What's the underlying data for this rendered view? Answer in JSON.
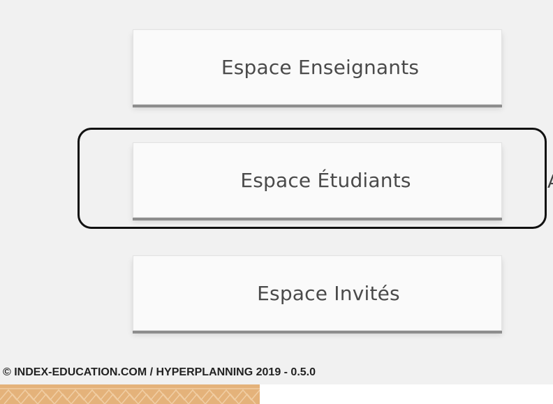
{
  "panel": {
    "background": "#f1f1f1"
  },
  "spaces": [
    {
      "label": "Espace Enseignants"
    },
    {
      "label": "Espace Étudiants"
    },
    {
      "label": "Espace Invités"
    }
  ],
  "edge_fragment": "A",
  "footer": {
    "copyright": "© INDEX-EDUCATION.COM / HYPERPLANNING 2019 - 0.5.0"
  },
  "colors": {
    "button_text": "#4a4a4a",
    "button_bg": "#fafafa",
    "button_shadow": "#8d8d8d",
    "highlight_border": "#111111",
    "footer_text": "#222222",
    "pattern_base": "#e4b27a",
    "pattern_lines": "#f1cfa6"
  }
}
